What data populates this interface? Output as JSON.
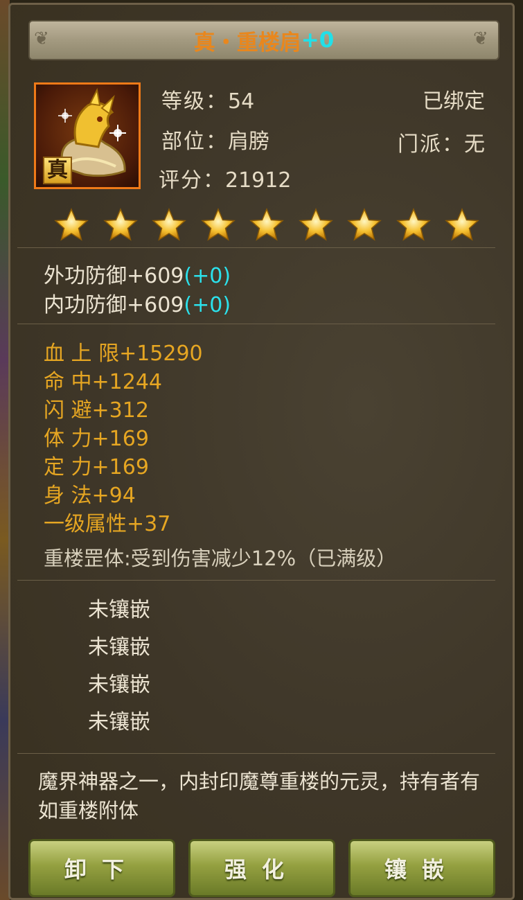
{
  "title": {
    "name": "真・重楼肩",
    "enhance": "+0"
  },
  "item": {
    "tier_badge": "真",
    "icon": "golden-dragon-shoulder-icon"
  },
  "info": {
    "level_label": "等级：",
    "level_value": "54",
    "bound": "已绑定",
    "slot_label": "部位：",
    "slot_value": "肩膀",
    "sect_label": "门派：",
    "sect_value": "无",
    "score_label": "评分：",
    "score_value": "21912"
  },
  "stars": {
    "count": 9,
    "max": 9
  },
  "base_stats": [
    {
      "text": "外功防御+609",
      "bonus": "(+0)"
    },
    {
      "text": "内功防御+609",
      "bonus": "(+0)"
    }
  ],
  "extra_stats": [
    "血 上 限+15290",
    "命  中+1244",
    "闪  避+312",
    "体  力+169",
    "定  力+169",
    "身  法+94",
    "一级属性+37"
  ],
  "set_effect": "重楼罡体:受到伤害减少12%（已满级）",
  "gem_slots": [
    "未镶嵌",
    "未镶嵌",
    "未镶嵌",
    "未镶嵌"
  ],
  "description": "魔界神器之一，内封印魔尊重楼的元灵，持有者有如重楼附体",
  "buttons": {
    "unequip": "卸下",
    "enhance": "强化",
    "inlay": "镶嵌"
  },
  "colors": {
    "title": "#e8871e",
    "cyan": "#2be1ec",
    "gold": "#e6a622",
    "button": "#94a040"
  }
}
